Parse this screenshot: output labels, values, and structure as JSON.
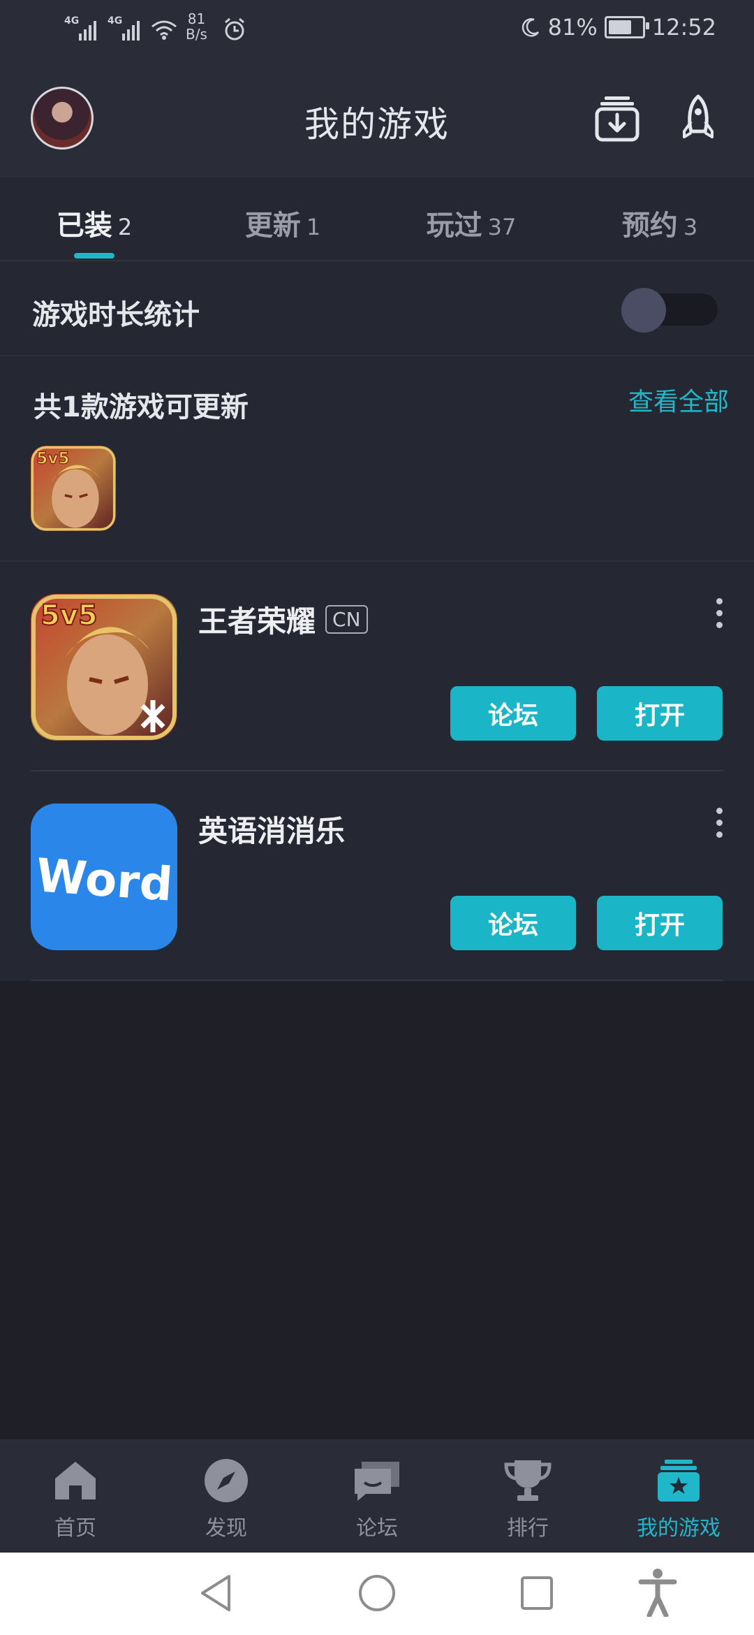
{
  "status_bar": {
    "signal1": "4G",
    "signal2": "4G",
    "net_speed_value": "81",
    "net_speed_unit": "B/s",
    "battery": "81%",
    "battery_level": 0.81,
    "time": "12:52"
  },
  "header": {
    "title": "我的游戏"
  },
  "tabs": [
    {
      "label": "已装",
      "count": "2"
    },
    {
      "label": "更新",
      "count": "1"
    },
    {
      "label": "玩过",
      "count": "37"
    },
    {
      "label": "预约",
      "count": "3"
    }
  ],
  "active_tab": 0,
  "stats": {
    "label": "游戏时长统计",
    "enabled": false
  },
  "update_section": {
    "title": "共1款游戏可更新",
    "view_all": "查看全部"
  },
  "games": [
    {
      "name": "王者荣耀",
      "badge": "CN",
      "forum": "论坛",
      "open": "打开",
      "icon": "honor-of-kings-icon"
    },
    {
      "name": "英语消消乐",
      "badge": "",
      "forum": "论坛",
      "open": "打开",
      "icon": "word-app-icon",
      "icon_text": "Word"
    }
  ],
  "bottom_nav": [
    {
      "label": "首页",
      "icon": "home-icon"
    },
    {
      "label": "发现",
      "icon": "compass-icon"
    },
    {
      "label": "论坛",
      "icon": "chat-icon"
    },
    {
      "label": "排行",
      "icon": "trophy-icon"
    },
    {
      "label": "我的游戏",
      "icon": "my-games-icon"
    }
  ],
  "colors": {
    "accent": "#1fb7c9",
    "background": "#1f1f28",
    "surface": "#252732"
  }
}
